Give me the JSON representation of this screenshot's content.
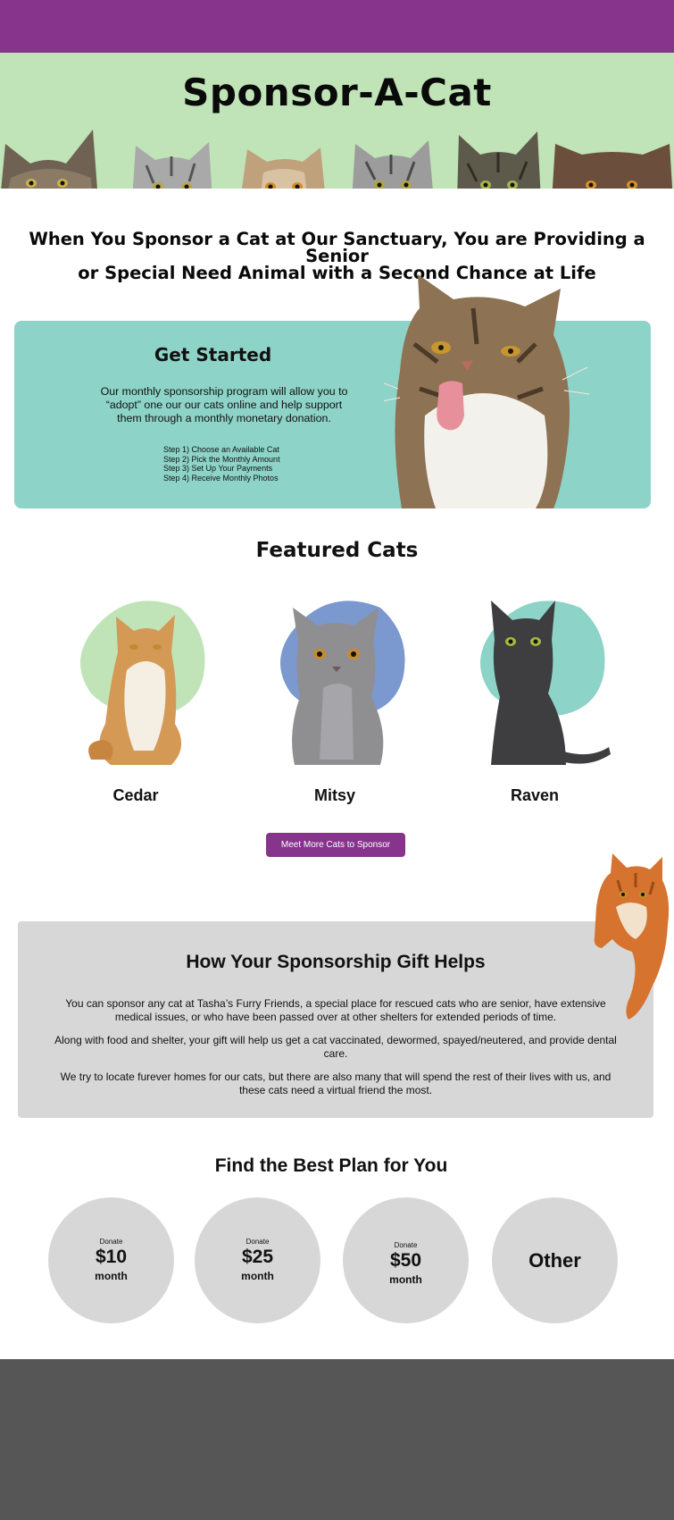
{
  "colors": {
    "brand_purple": "#87358c",
    "hero_green": "#c0e4b8",
    "teal": "#8dd3c7",
    "blue": "#7b98cf",
    "gray_panel": "#d7d7d7",
    "footer_gray": "#565656"
  },
  "hero": {
    "title": "Sponsor-A-Cat"
  },
  "tagline": {
    "line1": "When You Sponsor a Cat at Our Sanctuary, You are Providing a Senior",
    "line2": "or Special Need Animal with a Second Chance at Life"
  },
  "get_started": {
    "title": "Get Started",
    "body": "Our monthly sponsorship program will allow you to “adopt” one our our cats online and help support them through a monthly monetary donation.",
    "steps": [
      "Step 1) Choose an Available Cat",
      "Step 2) Pick the Monthly Amount",
      "Step 3) Set Up Your Payments",
      "Step 4) Receive Monthly Photos"
    ]
  },
  "featured": {
    "title": "Featured Cats",
    "cats": [
      {
        "name": "Cedar",
        "blob_color": "#c0e4b8"
      },
      {
        "name": "Mitsy",
        "blob_color": "#7b98cf"
      },
      {
        "name": "Raven",
        "blob_color": "#8dd3c7"
      }
    ],
    "button_label": "Meet More Cats to Sponsor"
  },
  "gift": {
    "title": "How Your Sponsorship Gift Helps",
    "paragraphs": [
      "You can sponsor any cat at Tasha’s Furry Friends, a special place for rescued cats who are senior, have extensive medical issues, or who have been passed over at other shelters for extended periods of time.",
      "Along with food and shelter, your gift will help us get a cat vaccinated, dewormed, spayed/neutered, and provide dental care.",
      "We try to locate furever homes for our cats, but there are also many that will spend the rest of their lives with us, and these cats need a virtual friend the most."
    ]
  },
  "plans": {
    "title": "Find the Best Plan for You",
    "items": [
      {
        "donate": "Donate",
        "amount": "$10",
        "unit": "month"
      },
      {
        "donate": "Donate",
        "amount": "$25",
        "unit": "month"
      },
      {
        "donate": "Donate",
        "amount": "$50",
        "unit": "month"
      },
      {
        "label": "Other"
      }
    ]
  }
}
